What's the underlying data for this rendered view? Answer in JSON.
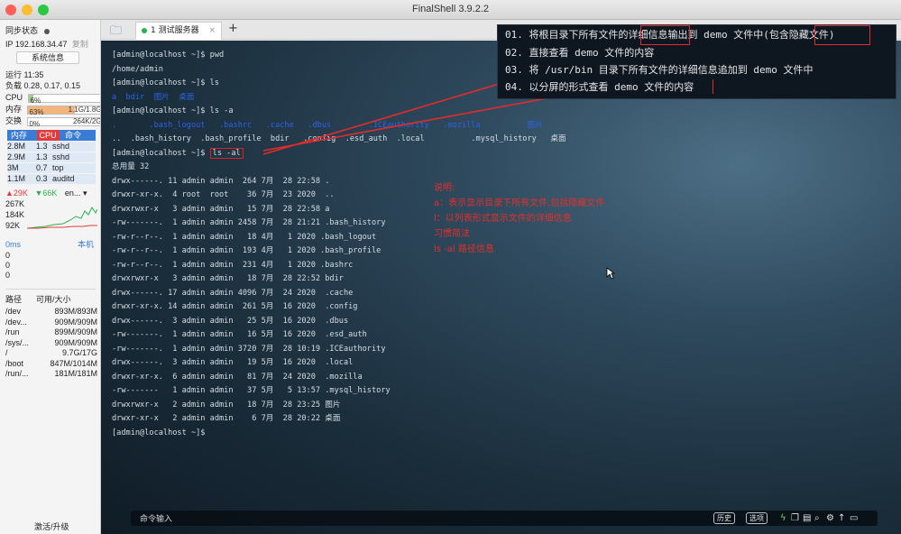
{
  "window": {
    "title": "FinalShell 3.9.2.2"
  },
  "sidebar": {
    "sync_status": "同步状态",
    "ip_label": "IP 192.168.34.47",
    "copy": "复制",
    "sys_info_btn": "系统信息",
    "uptime": "运行 11:35",
    "load": "负载 0.28, 0.17, 0.15",
    "cpu_label": "CPU",
    "cpu_value": "6%",
    "cpu_fraction": 0.06,
    "mem_label": "内存",
    "mem_pct": "63%",
    "mem_value": "1.1G/1.8G",
    "mem_fraction": 0.63,
    "swap_label": "交换",
    "swap_pct": "0%",
    "swap_value": "264K/2G",
    "swap_fraction": 0.0,
    "proc_head": {
      "mem": "内存",
      "cpu": "CPU",
      "cmd": "命令"
    },
    "processes": [
      {
        "mem": "2.8M",
        "cpu": "1.3",
        "cmd": "sshd"
      },
      {
        "mem": "2.9M",
        "cpu": "1.3",
        "cmd": "sshd"
      },
      {
        "mem": "3M",
        "cpu": "0.7",
        "cmd": "top"
      },
      {
        "mem": "1.1M",
        "cpu": "0.3",
        "cmd": "auditd"
      }
    ],
    "net_up": "29K",
    "net_down": "66K",
    "net_iface": "en...",
    "net_levels": [
      "267K",
      "184K",
      "92K"
    ],
    "ping_ms": "0ms",
    "ping_host": "本机",
    "ping_vals": [
      "0",
      "0",
      "0"
    ],
    "disk_header": {
      "path": "路径",
      "space": "可用/大小"
    },
    "disks": [
      {
        "path": "/dev",
        "space": "893M/893M"
      },
      {
        "path": "/dev...",
        "space": "909M/909M"
      },
      {
        "path": "/run",
        "space": "899M/909M"
      },
      {
        "path": "/sys/...",
        "space": "909M/909M"
      },
      {
        "path": "/",
        "space": "9.7G/17G"
      },
      {
        "path": "/boot",
        "space": "847M/1014M"
      },
      {
        "path": "/run/...",
        "space": "181M/181M"
      }
    ],
    "activate": "激活/升级"
  },
  "tabs": {
    "active_label": "1 测试服务器",
    "close": "×",
    "add": "+"
  },
  "terminal": {
    "lines": [
      {
        "t": "[admin@localhost ~]$ pwd"
      },
      {
        "t": "/home/admin"
      },
      {
        "t": "[admin@localhost ~]$ ls"
      },
      {
        "t": "a  bdir  图片  桌面",
        "c": "dir"
      },
      {
        "t": "[admin@localhost ~]$ ls -a"
      },
      {
        "t": ".       .bash_logout   .bashrc   .cache   .dbus        .ICEauthority   .mozilla          图片",
        "c": "dir"
      },
      {
        "t": "..  .bash_history  .bash_profile  bdir   .config  .esd_auth  .local          .mysql_history   桌面"
      },
      {
        "t": "[admin@localhost ~]$ ",
        "box": "ls -al"
      },
      {
        "t": "总用量 32"
      },
      {
        "t": "drwx------. 11 admin admin  264 7月  28 22:58 ."
      },
      {
        "t": "drwxr-xr-x.  4 root  root    36 7月  23 2020  .."
      },
      {
        "t": "drwxrwxr-x   3 admin admin   15 7月  28 22:58 a"
      },
      {
        "t": "-rw-------.  1 admin admin 2458 7月  28 21:21 .bash_history"
      },
      {
        "t": "-rw-r--r--.  1 admin admin   18 4月   1 2020 .bash_logout"
      },
      {
        "t": "-rw-r--r--.  1 admin admin  193 4月   1 2020 .bash_profile"
      },
      {
        "t": "-rw-r--r--.  1 admin admin  231 4月   1 2020 .bashrc"
      },
      {
        "t": "drwxrwxr-x   3 admin admin   18 7月  28 22:52 bdir"
      },
      {
        "t": "drwx------. 17 admin admin 4096 7月  24 2020  .cache"
      },
      {
        "t": "drwxr-xr-x. 14 admin admin  261 5月  16 2020  .config"
      },
      {
        "t": "drwx------.  3 admin admin   25 5月  16 2020  .dbus"
      },
      {
        "t": "-rw-------.  1 admin admin   16 5月  16 2020  .esd_auth"
      },
      {
        "t": "-rw-------.  1 admin admin 3720 7月  28 10:19 .ICEauthority"
      },
      {
        "t": "drwx------.  3 admin admin   19 5月  16 2020  .local"
      },
      {
        "t": "drwxr-xr-x.  6 admin admin   81 7月  24 2020  .mozilla"
      },
      {
        "t": "-rw-------   1 admin admin   37 5月   5 13:57 .mysql_history"
      },
      {
        "t": "drwxrwxr-x   2 admin admin   18 7月  28 23:25 图片"
      },
      {
        "t": "drwxr-xr-x   2 admin admin    6 7月  28 20:22 桌面"
      },
      {
        "t": "[admin@localhost ~]$"
      }
    ]
  },
  "tasks": [
    "01. 将根目录下所有文件的详细信息输出到 demo 文件中(包含隐藏文件)",
    "02. 直接查看 demo 文件的内容",
    "03. 将 /usr/bin 目录下所有文件的详细信息追加到 demo 文件中",
    "04. 以分屏的形式查看 demo 文件的内容"
  ],
  "annotation": [
    "说明:",
    "a：表示显示目录下所有文件,包括隐藏文件",
    "l：以列表形式显示文件的详细信息",
    "习惯简法",
    "ls -al 路径信息"
  ],
  "cmdbar": {
    "input_label": "命令输入",
    "history": "历史",
    "options": "选项"
  },
  "colors": {
    "annotation_red": "#e3302b",
    "dir_blue": "#2b62e6"
  }
}
